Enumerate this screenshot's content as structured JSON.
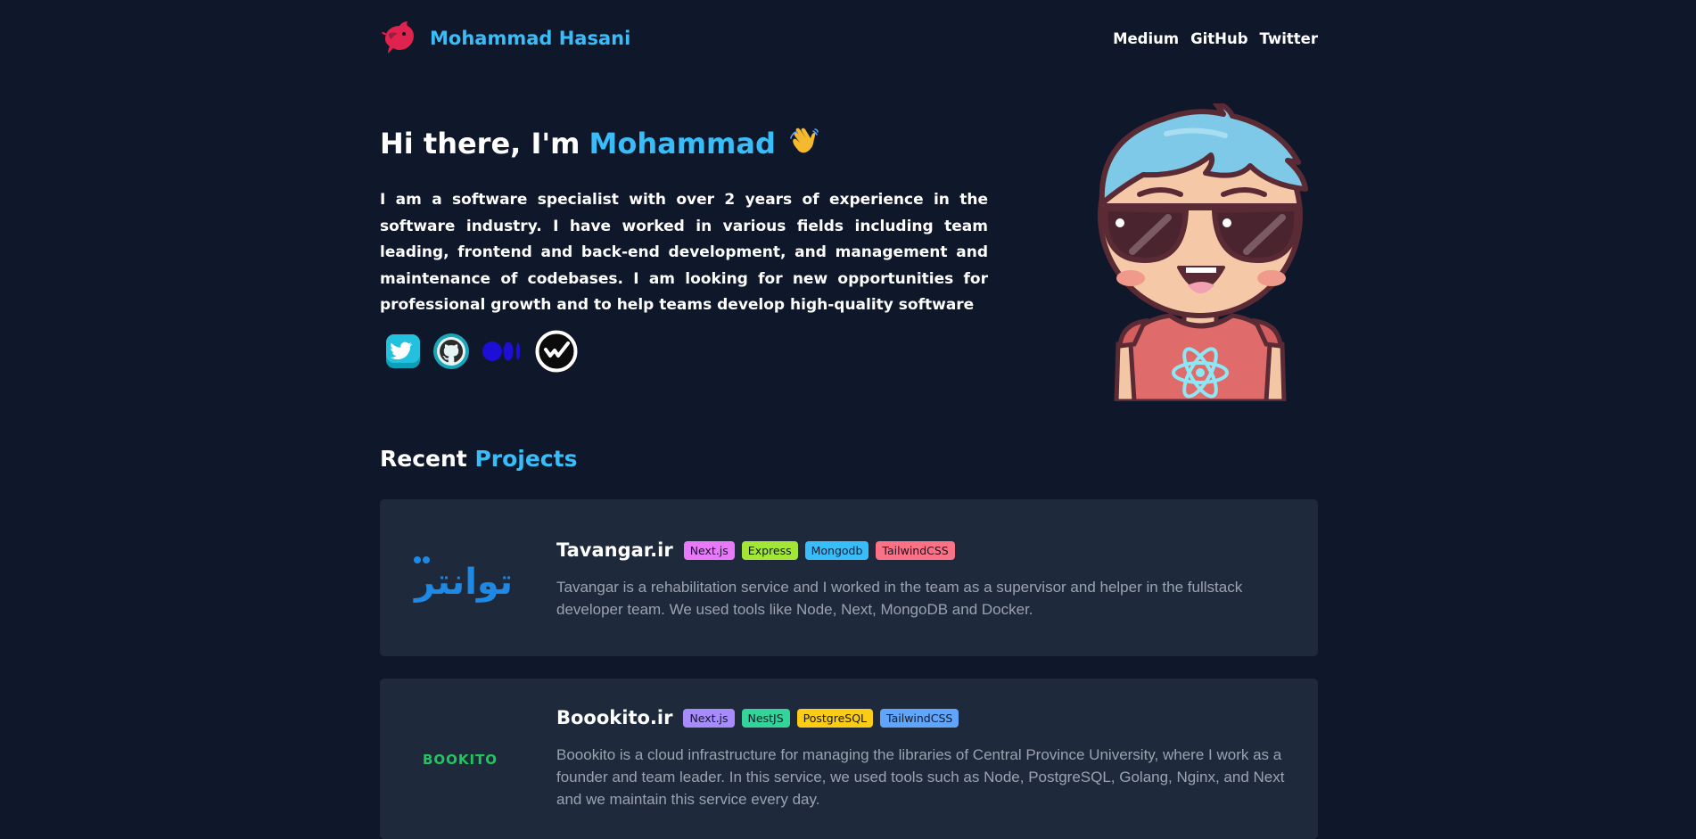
{
  "header": {
    "name": "Mohammad Hasani",
    "nav": [
      "Medium",
      "GitHub",
      "Twitter"
    ]
  },
  "hero": {
    "greeting": "Hi there, I'm",
    "name": "Mohammad",
    "bio": "I am a software specialist with over 2 years of experience in the software industry. I have worked in various fields including team leading, frontend and back-end development, and management and maintenance of codebases. I am looking for new opportunities for professional growth and to help teams develop high-quality software",
    "socials": [
      "twitter-icon",
      "github-icon",
      "medium-icon",
      "wakatime-icon"
    ]
  },
  "projects": {
    "title_plain": "Recent",
    "title_accent": "Projects",
    "items": [
      {
        "title": "Tavangar.ir",
        "logo_text": "توانتر",
        "tags": [
          {
            "label": "Next.js",
            "color": "#e879f9"
          },
          {
            "label": "Express",
            "color": "#a3e635"
          },
          {
            "label": "Mongodb",
            "color": "#38bdf8"
          },
          {
            "label": "TailwindCSS",
            "color": "#fb7185"
          }
        ],
        "description": "Tavangar is a rehabilitation service and I worked in the team as a supervisor and helper in the fullstack developer team. We used tools like Node, Next, MongoDB and Docker."
      },
      {
        "title": "Boookito.ir",
        "logo_text": "BOOKITO",
        "tags": [
          {
            "label": "Next.js",
            "color": "#a78bfa"
          },
          {
            "label": "NestJS",
            "color": "#34d399"
          },
          {
            "label": "PostgreSQL",
            "color": "#facc15"
          },
          {
            "label": "TailwindCSS",
            "color": "#60a5fa"
          }
        ],
        "description": "Boookito is a cloud infrastructure for managing the libraries of Central Province University, where I work as a founder and team leader. In this service, we used tools such as Node, PostgreSQL, Golang, Nginx, and Next and we maintain this service every day."
      }
    ]
  },
  "colors": {
    "background": "#0f172a",
    "accent": "#38bdf8",
    "card": "#1e293b",
    "brand_logo": "#e0234e"
  }
}
